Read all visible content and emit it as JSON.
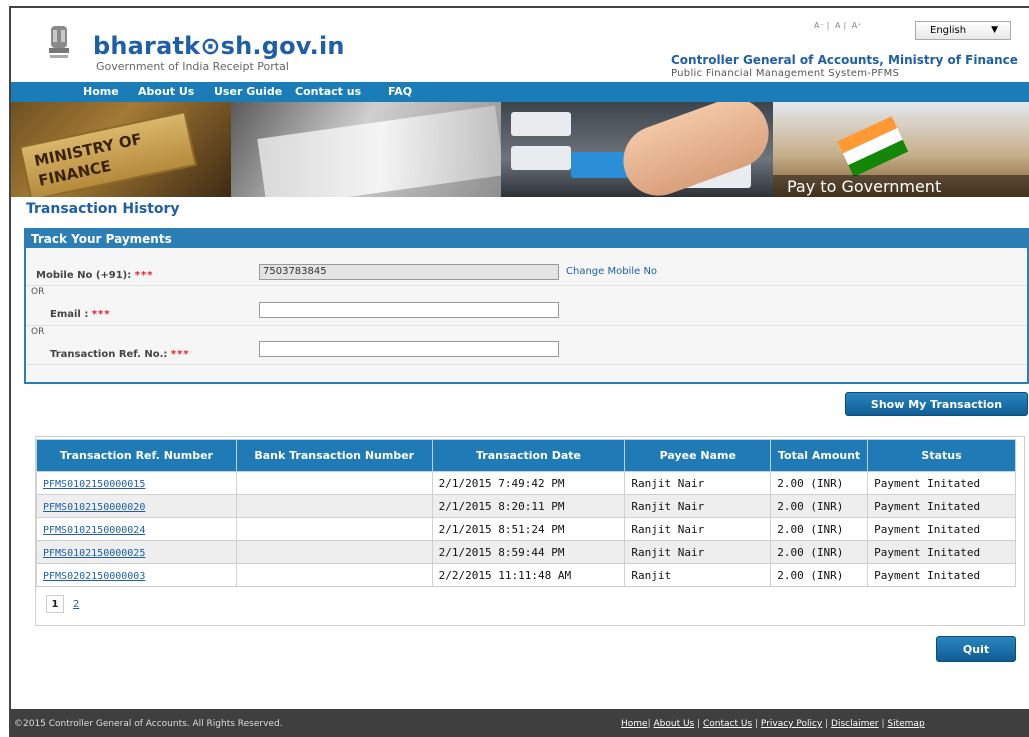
{
  "header": {
    "site_name": "bharatk⊙sh.gov.in",
    "site_subtitle": "Government of India Receipt Portal",
    "font_small": "A⁻",
    "font_normal": "A",
    "font_large": "A⁺",
    "language": "English",
    "org_title": "Controller General of Accounts, Ministry of Finance",
    "org_subtitle": "Public Financial Management System-PFMS"
  },
  "nav": [
    "Home",
    "About Us",
    "User Guide",
    "Contact us",
    "FAQ"
  ],
  "banner": {
    "sign_text": "MINISTRY OF FINANCE",
    "tagline": "Pay to Government"
  },
  "page_title": "Transaction History",
  "track": {
    "title": "Track Your Payments",
    "mobile_label": "Mobile No (+91):",
    "mobile_value": "7503783845",
    "change_mobile": "Change Mobile No",
    "or_text": "OR",
    "email_label": "Email :",
    "txn_ref_label": "Transaction Ref. No.:",
    "required_mark": "***"
  },
  "show_button": "Show My Transaction",
  "table": {
    "headers": [
      "Transaction Ref. Number",
      "Bank Transaction Number",
      "Transaction Date",
      "Payee Name",
      "Total Amount",
      "Status"
    ],
    "rows": [
      {
        "ref": "PFMS0102150000015",
        "bank": "",
        "date": "2/1/2015 7:49:42 PM",
        "payee": "Ranjit Nair",
        "amount": "2.00 (INR)",
        "status": "Payment Initated"
      },
      {
        "ref": "PFMS0102150000020",
        "bank": "",
        "date": "2/1/2015 8:20:11 PM",
        "payee": "Ranjit Nair",
        "amount": "2.00 (INR)",
        "status": "Payment Initated"
      },
      {
        "ref": "PFMS0102150000024",
        "bank": "",
        "date": "2/1/2015 8:51:24 PM",
        "payee": "Ranjit Nair",
        "amount": "2.00 (INR)",
        "status": "Payment Initated"
      },
      {
        "ref": "PFMS0102150000025",
        "bank": "",
        "date": "2/1/2015 8:59:44 PM",
        "payee": "Ranjit Nair",
        "amount": "2.00 (INR)",
        "status": "Payment Initated"
      },
      {
        "ref": "PFMS0202150000003",
        "bank": "",
        "date": "2/2/2015 11:11:48 AM",
        "payee": "Ranjit",
        "amount": "2.00 (INR)",
        "status": "Payment Initated"
      }
    ],
    "pages": [
      "1",
      "2"
    ]
  },
  "quit_button": "Quit",
  "footer": {
    "copyright": "©2015 Controller General of Accounts. All Rights Reserved.",
    "links": [
      "Home",
      "About Us",
      "Contact Us",
      "Privacy Policy",
      "Disclaimer",
      "Sitemap"
    ]
  },
  "colors": {
    "brand": "#1f5fa8",
    "nav": "#1a7db8",
    "footer": "#3f3f3f"
  }
}
